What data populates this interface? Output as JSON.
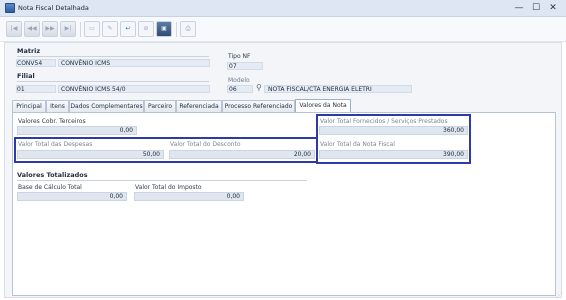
{
  "window": {
    "title": "Nota Fiscal Detalhada",
    "minimize_glyph": "—",
    "maximize_glyph": "☐",
    "close_glyph": "✕"
  },
  "toolbar": {
    "icons": [
      "first-record-icon",
      "previous-record-icon",
      "next-record-icon",
      "last-record-icon",
      "new-document-icon",
      "edit-pencil-icon",
      "undo-icon",
      "cancel-icon",
      "save-floppy-icon",
      "print-icon"
    ]
  },
  "matriz": {
    "label": "Matriz",
    "code": "CONV54",
    "name": "CONVÊNIO ICMS"
  },
  "filial": {
    "label": "Filial",
    "code": "01",
    "name": "CONVÊNIO ICMS 54/0"
  },
  "tipo_nf": {
    "label": "Tipo NF",
    "value": "07"
  },
  "modelo": {
    "label": "Modelo",
    "code": "06",
    "name": "NOTA FISCAL/CTA ENERGIA ELETRI"
  },
  "tabs": [
    "Principal",
    "Itens",
    "Dados Complementares",
    "Parceiro",
    "Referenciada",
    "Processo Referenciado",
    "Valores da Nota"
  ],
  "active_tab": "Valores da Nota",
  "valores": {
    "cobr_terceiros_label": "Valores Cobr. Terceiros",
    "cobr_terceiros_value": "0,00",
    "despesas_label": "Valor Total das Despesas",
    "despesas_value": "50,00",
    "desconto_label": "Valor Total do Desconto",
    "desconto_value": "20,00",
    "fornecidos_label": "Valor Total Fornecidos / Serviços Prestados",
    "fornecidos_value": "360,00",
    "total_nota_label": "Valor Total da Nota Fiscal",
    "total_nota_value": "390,00"
  },
  "totalizados": {
    "section_label": "Valores Totalizados",
    "base_calculo_label": "Base de Cálculo Total",
    "base_calculo_value": "0,00",
    "imposto_label": "Valor Total do Imposto",
    "imposto_value": "0,00"
  },
  "colors": {
    "highlight": "#2d3aa8",
    "field_bg": "#dfe6ef"
  }
}
